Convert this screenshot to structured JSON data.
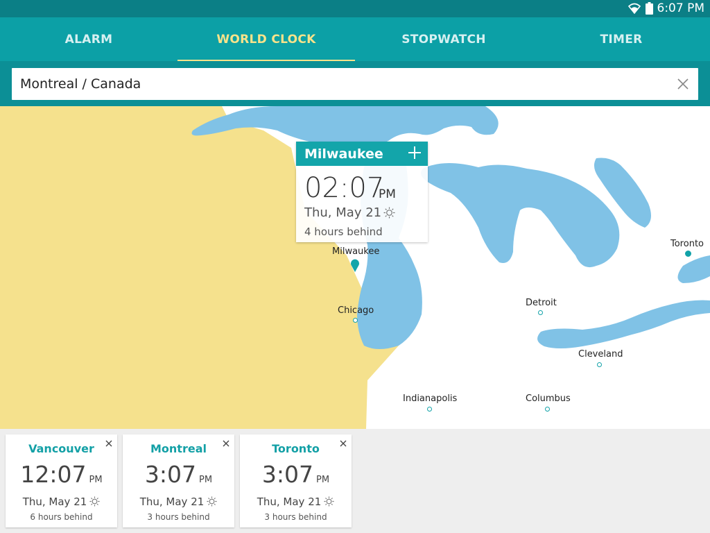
{
  "status_bar": {
    "time": "6:07 PM"
  },
  "tabs": [
    {
      "label": "ALARM",
      "active": false
    },
    {
      "label": "WORLD CLOCK",
      "active": true
    },
    {
      "label": "STOPWATCH",
      "active": false
    },
    {
      "label": "TIMER",
      "active": false
    }
  ],
  "search": {
    "value": "Montreal / Canada"
  },
  "map": {
    "cities": {
      "milwaukee": "Milwaukee",
      "chicago": "Chicago",
      "detroit": "Detroit",
      "toronto": "Toronto",
      "cleveland": "Cleveland",
      "indianapolis": "Indianapolis",
      "columbus": "Columbus"
    }
  },
  "popup": {
    "city": "Milwaukee",
    "time": "02:07",
    "ampm": "PM",
    "date": "Thu, May 21",
    "behind": "4 hours behind"
  },
  "cards": [
    {
      "city": "Vancouver",
      "time": "12:07",
      "ampm": "PM",
      "date": "Thu, May 21",
      "behind": "6 hours behind"
    },
    {
      "city": "Montreal",
      "time": "3:07",
      "ampm": "PM",
      "date": "Thu, May 21",
      "behind": "3 hours behind"
    },
    {
      "city": "Toronto",
      "time": "3:07",
      "ampm": "PM",
      "date": "Thu, May 21",
      "behind": "3 hours behind"
    }
  ],
  "colors": {
    "status_bar": "#0b7f86",
    "tab_bar": "#0ca0a6",
    "active_tab": "#f9e38a",
    "land_highlight": "#f5e18d",
    "water": "#80c2e6",
    "accent": "#13a5aa"
  }
}
